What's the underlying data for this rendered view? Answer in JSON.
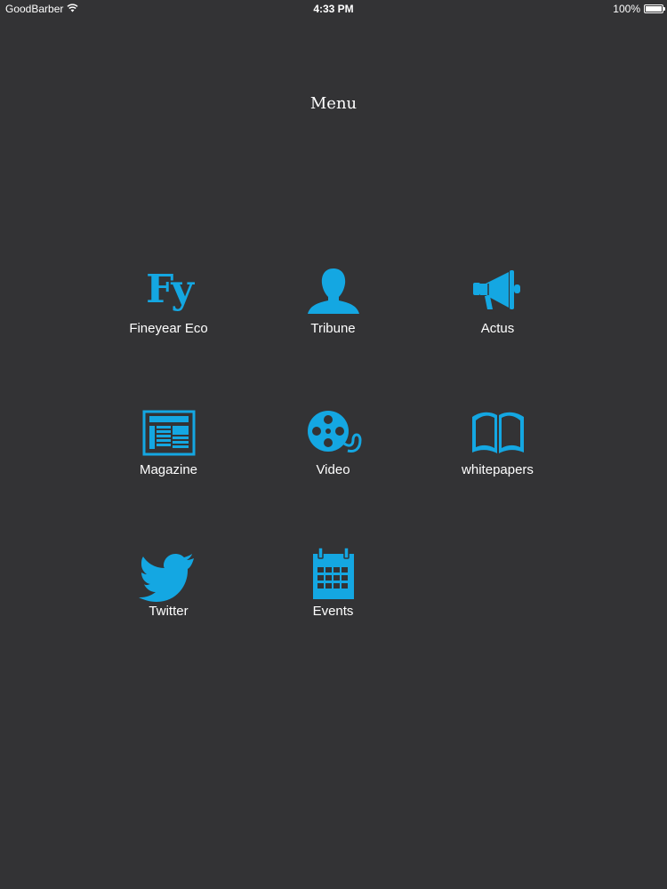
{
  "status_bar": {
    "carrier": "GoodBarber",
    "time": "4:33 PM",
    "battery": "100%",
    "battery_level": 1.0
  },
  "header": {
    "title": "Menu"
  },
  "accent_color": "#14a7e2",
  "background_color": "#333335",
  "menu": {
    "items": [
      {
        "label": "Fineyear Eco",
        "icon": "fineyear-logo",
        "logo_text": "Fy"
      },
      {
        "label": "Tribune",
        "icon": "person-icon"
      },
      {
        "label": "Actus",
        "icon": "megaphone-icon"
      },
      {
        "label": "Magazine",
        "icon": "newspaper-icon"
      },
      {
        "label": "Video",
        "icon": "film-reel-icon"
      },
      {
        "label": "whitepapers",
        "icon": "open-book-icon"
      },
      {
        "label": "Twitter",
        "icon": "twitter-bird-icon"
      },
      {
        "label": "Events",
        "icon": "calendar-icon"
      }
    ]
  }
}
